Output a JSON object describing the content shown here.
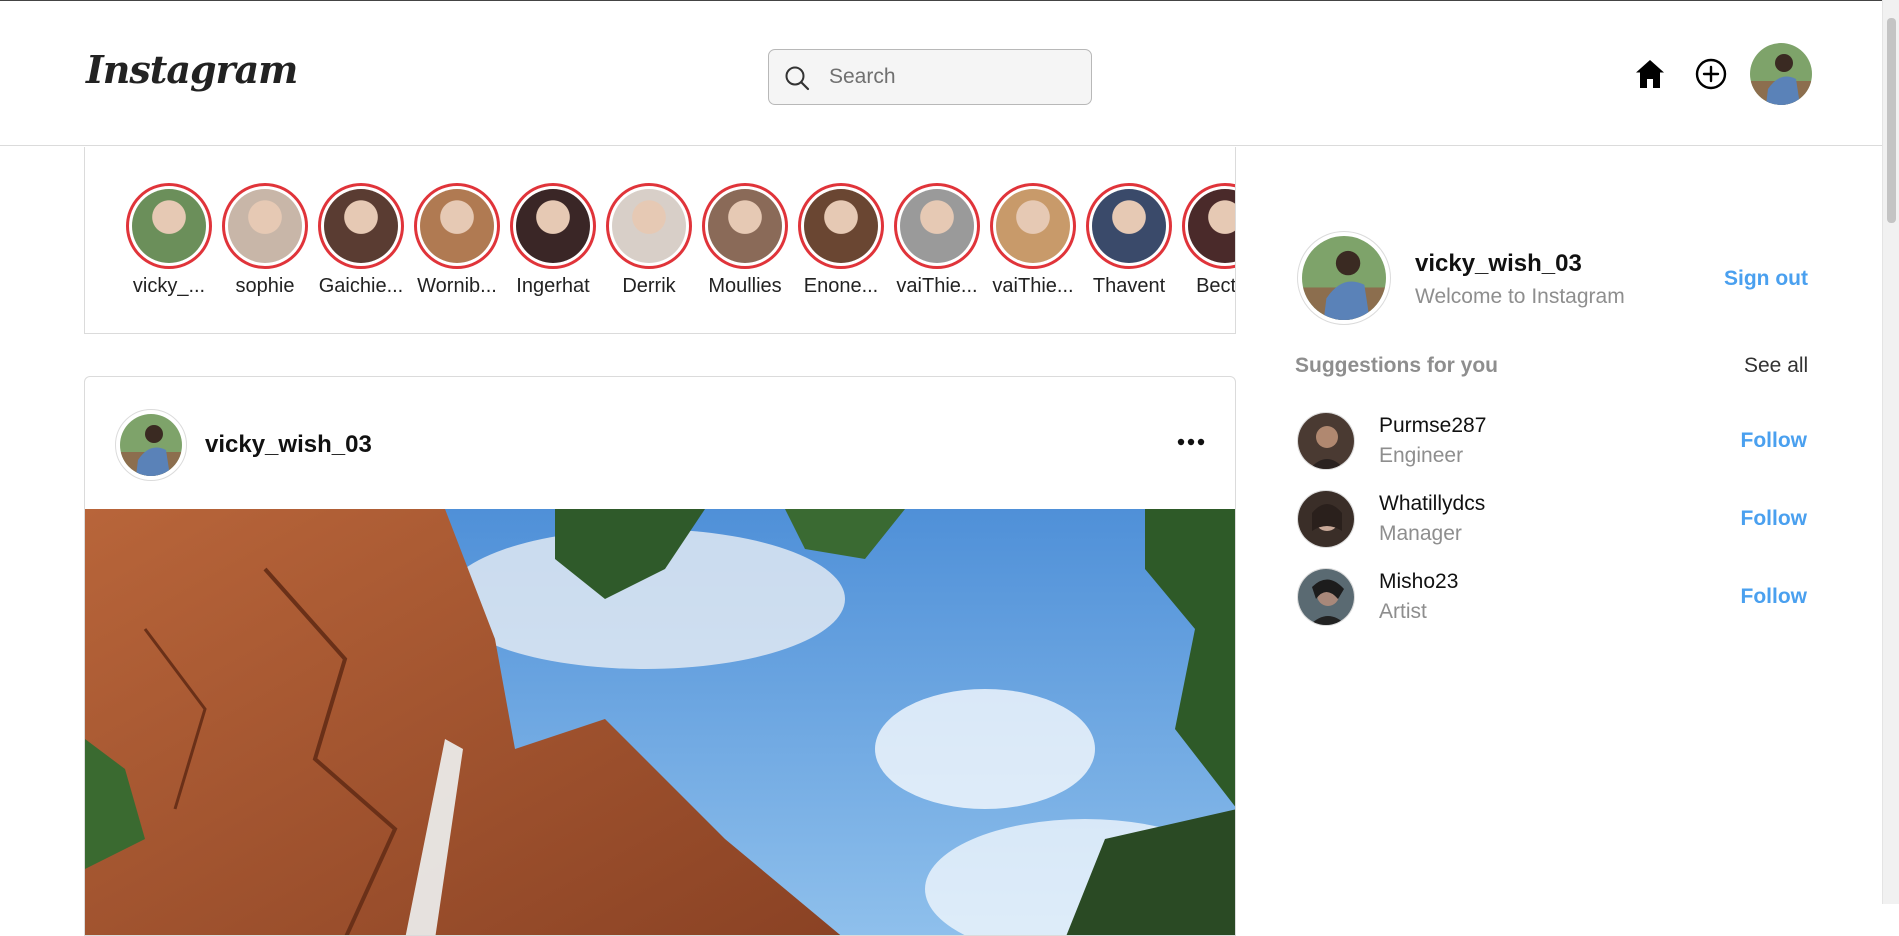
{
  "app": {
    "logo_text": "Instagram"
  },
  "header": {
    "search_placeholder": "Search",
    "icons": [
      "search-icon",
      "home-icon",
      "add-post-icon",
      "avatar"
    ]
  },
  "stories": [
    {
      "label": "vicky_...",
      "avatar_color": "#6b8f5a"
    },
    {
      "label": "sophie",
      "avatar_color": "#c8b6a8"
    },
    {
      "label": "Gaichie...",
      "avatar_color": "#5a3c32"
    },
    {
      "label": "Wornib...",
      "avatar_color": "#b07a52"
    },
    {
      "label": "Ingerhat",
      "avatar_color": "#3a2626"
    },
    {
      "label": "Derrik",
      "avatar_color": "#d8cfc8"
    },
    {
      "label": "Moullies",
      "avatar_color": "#8a6a58"
    },
    {
      "label": "Enone...",
      "avatar_color": "#6a4632"
    },
    {
      "label": "vaiThie...",
      "avatar_color": "#9a9a9a"
    },
    {
      "label": "vaiThie...",
      "avatar_color": "#c89a6a"
    },
    {
      "label": "Thavent",
      "avatar_color": "#3a4a6a"
    },
    {
      "label": "Becter",
      "avatar_color": "#4a2a2a"
    }
  ],
  "post": {
    "username": "vicky_wish_03",
    "more_icon": "more-horizontal-icon"
  },
  "profile": {
    "username": "vicky_wish_03",
    "subtitle": "Welcome to Instagram",
    "signout_label": "Sign out"
  },
  "suggestions": {
    "title": "Suggestions for you",
    "see_all_label": "See all",
    "items": [
      {
        "name": "Purmse287",
        "role": "Engineer",
        "follow_label": "Follow",
        "avatar_color": "#4a3a32"
      },
      {
        "name": "Whatillydcs",
        "role": "Manager",
        "follow_label": "Follow",
        "avatar_color": "#5a4a40"
      },
      {
        "name": "Misho23",
        "role": "Artist",
        "follow_label": "Follow",
        "avatar_color": "#3a3a3a"
      }
    ]
  },
  "colors": {
    "accent_blue": "#4aa0ef",
    "story_ring": "#e0343a",
    "border": "#dbdbdb",
    "muted_text": "#8e8e8e"
  }
}
